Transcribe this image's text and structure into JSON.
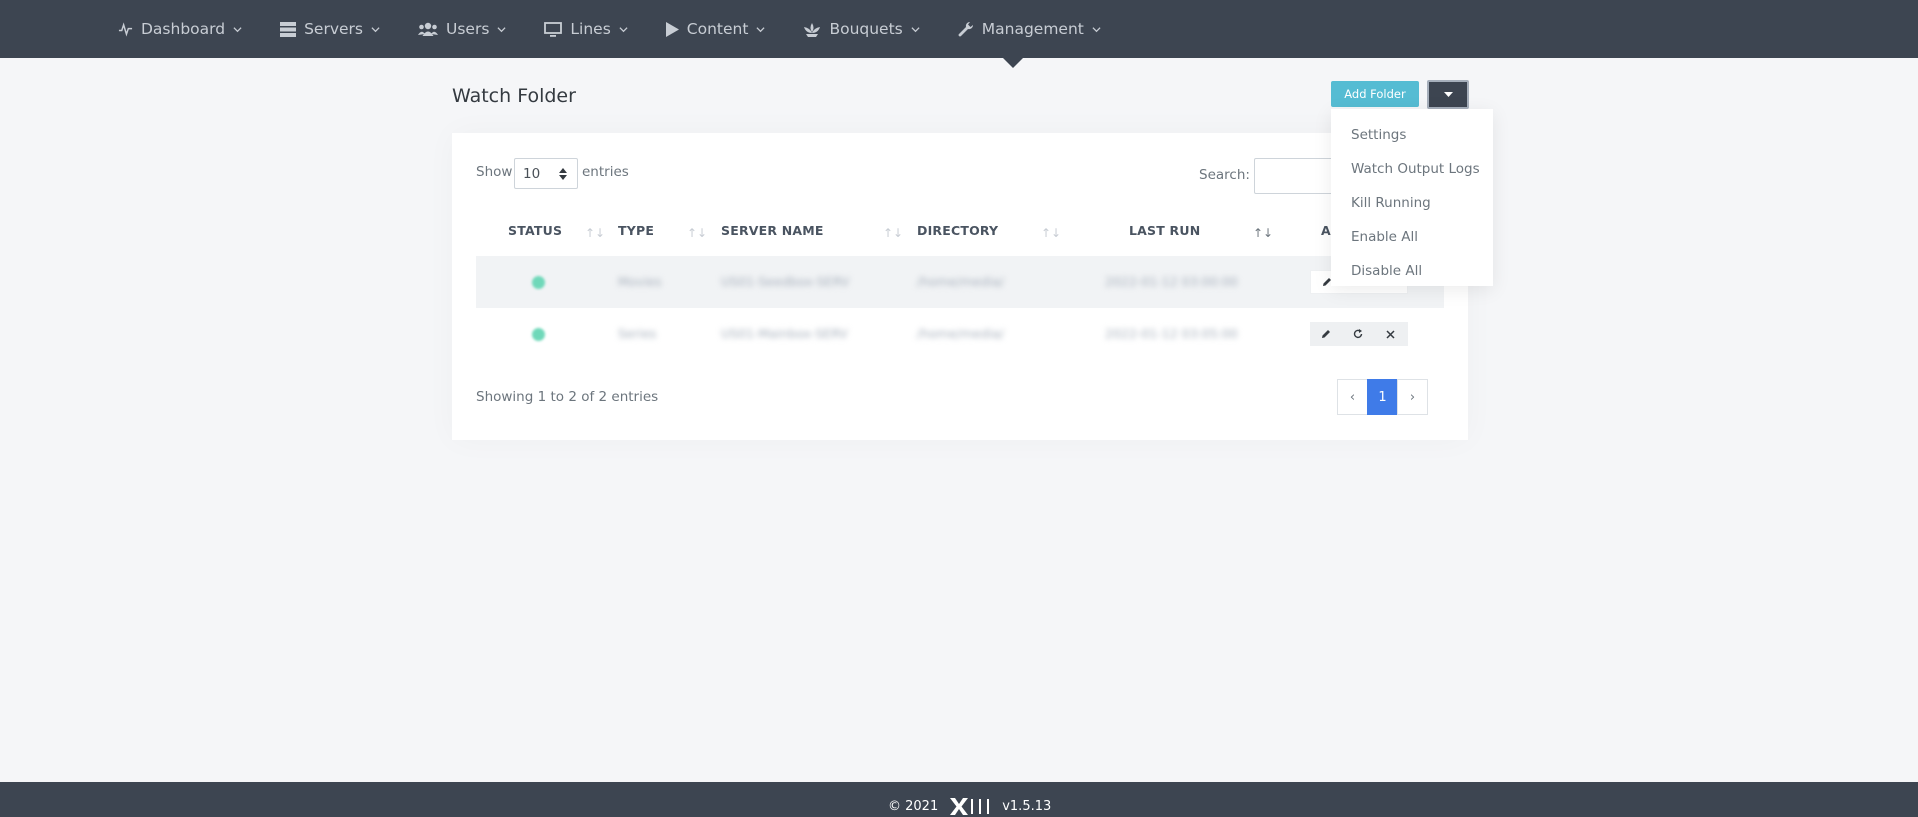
{
  "nav": {
    "items": [
      {
        "label": "Dashboard",
        "icon": "activity-icon"
      },
      {
        "label": "Servers",
        "icon": "server-icon"
      },
      {
        "label": "Users",
        "icon": "users-icon"
      },
      {
        "label": "Lines",
        "icon": "monitor-icon"
      },
      {
        "label": "Content",
        "icon": "play-icon"
      },
      {
        "label": "Bouquets",
        "icon": "bouquet-icon"
      },
      {
        "label": "Management",
        "icon": "wrench-icon"
      }
    ]
  },
  "page": {
    "title": "Watch Folder",
    "add_button": "Add Folder"
  },
  "dropdown": {
    "items": [
      "Settings",
      "Watch Output Logs",
      "Kill Running",
      "Enable All",
      "Disable All"
    ]
  },
  "table": {
    "show_label": "Show",
    "page_length": "10",
    "entries_label": "entries",
    "search_label": "Search:",
    "columns": [
      "STATUS",
      "TYPE",
      "SERVER NAME",
      "DIRECTORY",
      "LAST RUN",
      "ACTIONS"
    ],
    "columns_visible": [
      "STATUS",
      "TYPE",
      "SERVER NAME",
      "DIRECTORY",
      "LAST RUN",
      "A"
    ],
    "rows": [
      {
        "type": "Movies",
        "server": "US01-Seedbox-SERV",
        "directory": "/home/media/",
        "last_run": "2022-01-12 03:00:00"
      },
      {
        "type": "Series",
        "server": "US01-Mainbox-SERV",
        "directory": "/home/media/",
        "last_run": "2022-01-12 03:05:00"
      }
    ],
    "info": "Showing 1 to 2 of 2 entries",
    "pagination": {
      "prev": "‹",
      "current": "1",
      "next": "›"
    }
  },
  "footer": {
    "copyright": "© 2021",
    "version": "v1.5.13"
  },
  "colors": {
    "nav_bg": "#3d4551",
    "accent_info": "#55bcd3",
    "primary": "#3f7be8",
    "status_ok": "#6fd8b9"
  }
}
